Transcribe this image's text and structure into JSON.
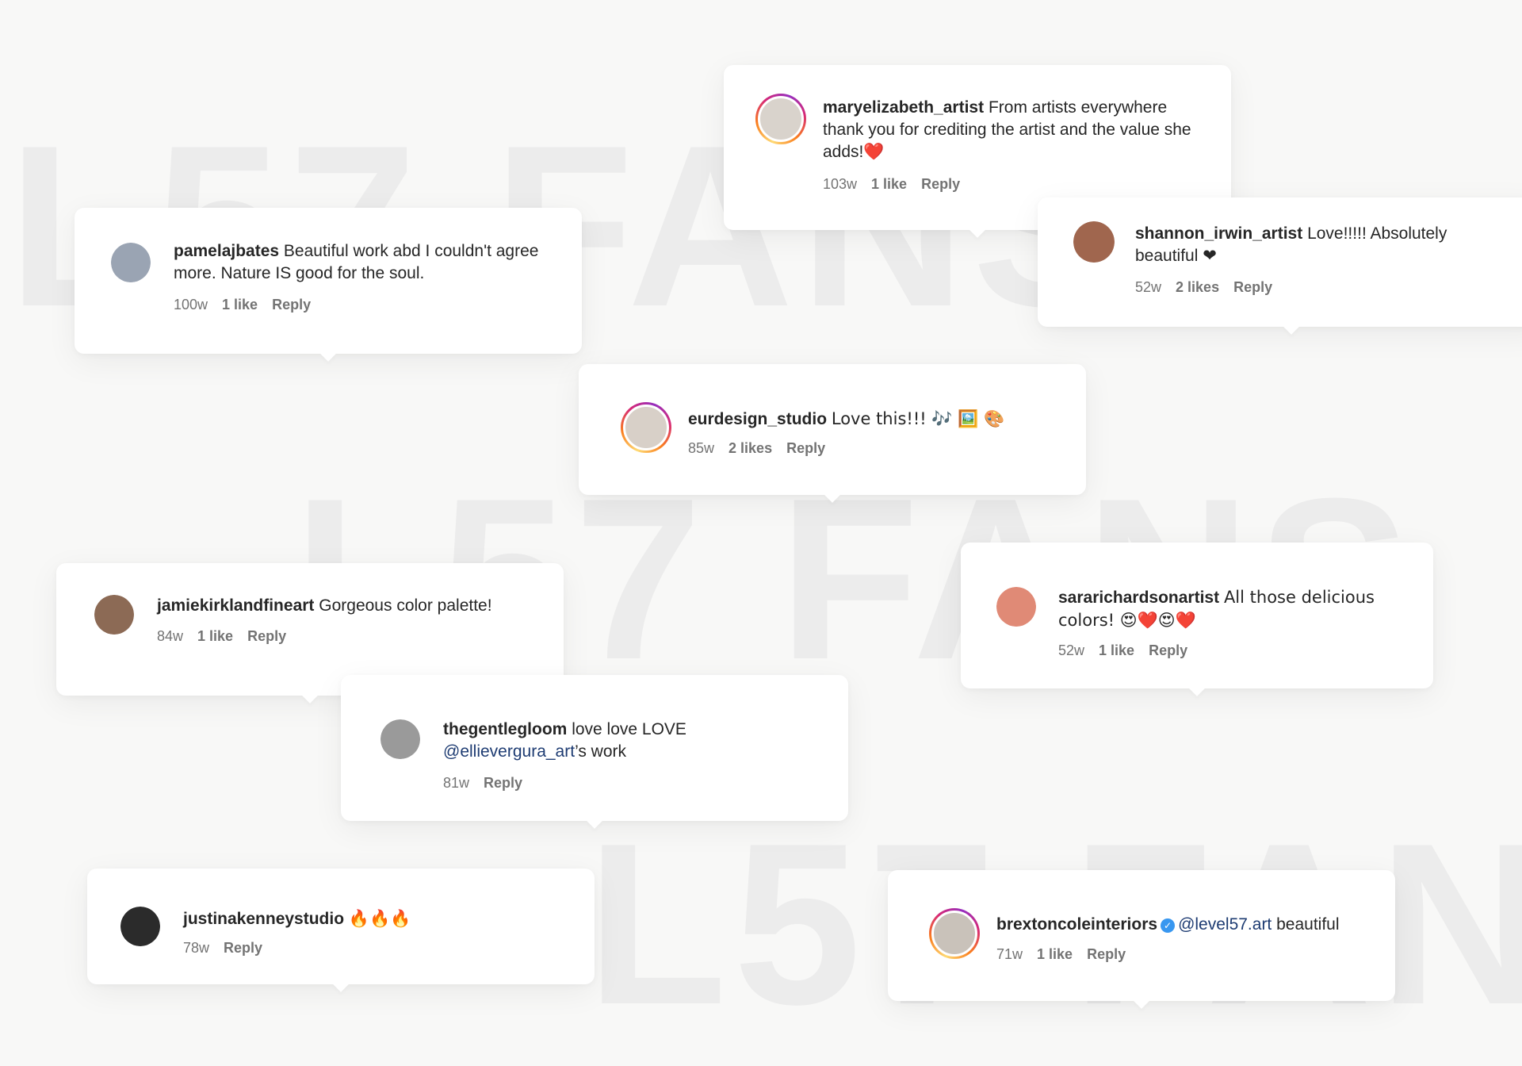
{
  "watermark": {
    "text": "L57 FANS"
  },
  "comments": [
    {
      "user": "maryelizabeth_artist",
      "text": "From artists everywhere thank you for crediting the artist and the value she adds!❤️",
      "age": "103w",
      "likes": "1 like",
      "reply": "Reply",
      "avatar_color": "#d9d3cc"
    },
    {
      "user": "pamelajbates",
      "text": "Beautiful work abd I couldn't agree more. Nature IS good for the soul.",
      "age": "100w",
      "likes": "1 like",
      "reply": "Reply",
      "avatar_color": "#9aa4b3"
    },
    {
      "user": "shannon_irwin_artist",
      "text": "Love!!!!! Absolutely beautiful ❤",
      "age": "52w",
      "likes": "2 likes",
      "reply": "Reply",
      "avatar_color": "#a0664e"
    },
    {
      "user": "eurdesign_studio",
      "text": "Love this!!! 🎶 🖼️ 🎨",
      "age": "85w",
      "likes": "2 likes",
      "reply": "Reply",
      "avatar_color": "#d8d0c8"
    },
    {
      "user": "jamiekirklandfineart",
      "text": "Gorgeous color palette!",
      "age": "84w",
      "likes": "1 like",
      "reply": "Reply",
      "avatar_color": "#8c6a55"
    },
    {
      "user": "sararichardsonartist",
      "text": "All those delicious colors! 😍❤️😍❤️",
      "age": "52w",
      "likes": "1 like",
      "reply": "Reply",
      "avatar_color": "#e08a76"
    },
    {
      "user": "thegentlegloom",
      "text_before": "love love LOVE",
      "mention": "@ellievergura_art",
      "text_after": "’s work",
      "age": "81w",
      "reply": "Reply",
      "avatar_color": "#9a9a9a"
    },
    {
      "user": "justinakenneystudio",
      "text": "🔥🔥🔥",
      "age": "78w",
      "reply": "Reply",
      "avatar_color": "#2b2b2b"
    },
    {
      "user": "brextoncoleinteriors",
      "mention": "@level57.art",
      "text_after": "beautiful",
      "age": "71w",
      "likes": "1 like",
      "reply": "Reply",
      "avatar_color": "#c9c2ba"
    }
  ],
  "colors": {
    "background": "#f8f8f7",
    "mention": "#1d3b72",
    "meta": "#737373",
    "verified": "#3897f0"
  }
}
